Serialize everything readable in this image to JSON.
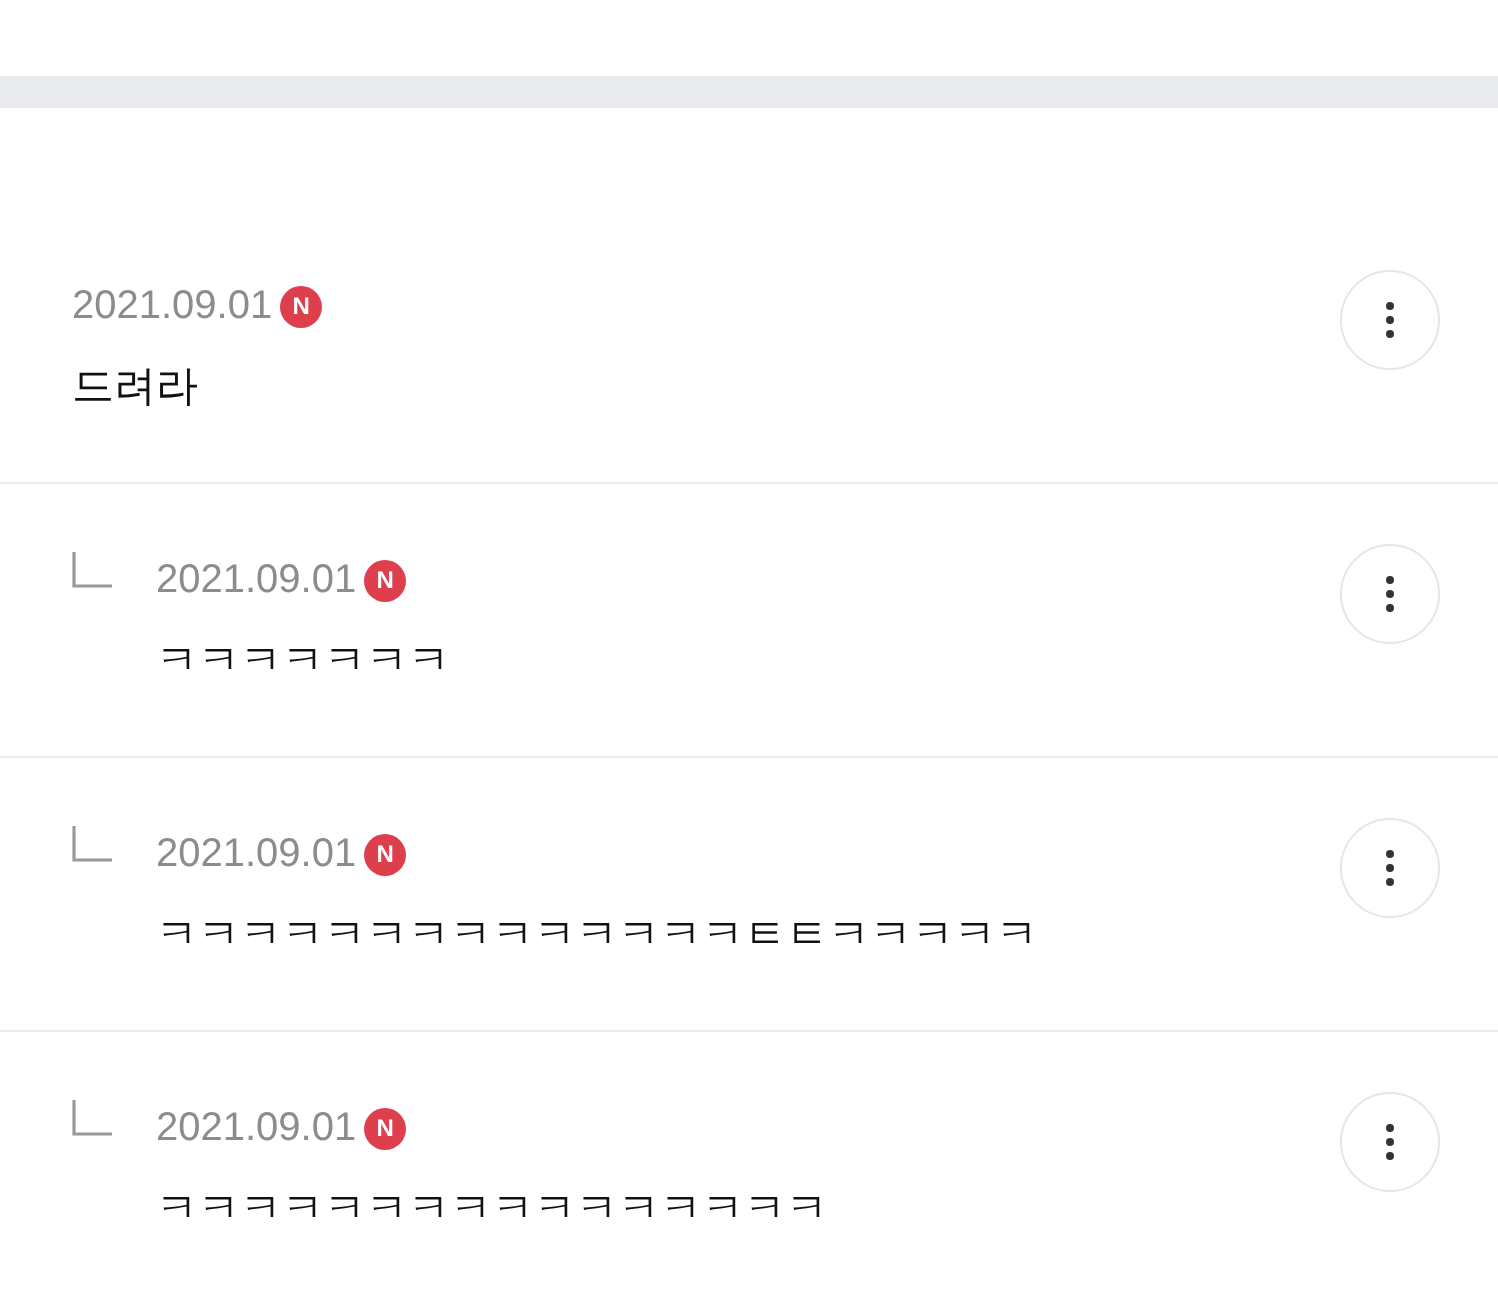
{
  "comments": [
    {
      "kind": "comment",
      "date": "2021.09.01",
      "badge": "N",
      "text": "드려라"
    },
    {
      "kind": "reply",
      "date": "2021.09.01",
      "badge": "N",
      "text": "ㅋㅋㅋㅋㅋㅋㅋ"
    },
    {
      "kind": "reply",
      "date": "2021.09.01",
      "badge": "N",
      "text": "ㅋㅋㅋㅋㅋㅋㅋㅋㅋㅋㅋㅋㅋㅋㅌㅌㅋㅋㅋㅋㅋ"
    },
    {
      "kind": "reply",
      "date": "2021.09.01",
      "badge": "N",
      "text": "ㅋㅋㅋㅋㅋㅋㅋㅋㅋㅋㅋㅋㅋㅋㅋㅋ"
    }
  ]
}
